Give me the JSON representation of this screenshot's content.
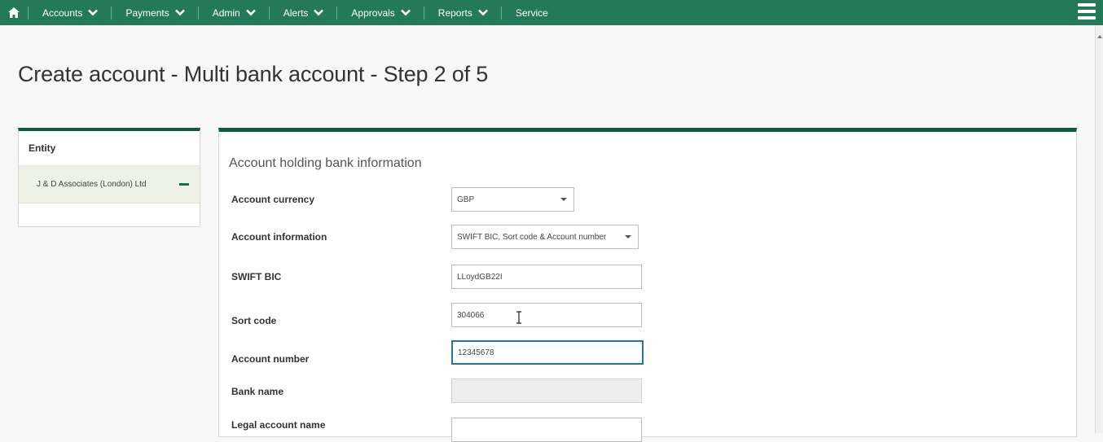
{
  "colors": {
    "nav_bg": "#24795a",
    "accent": "#0f5a44",
    "entity_selected_bg": "#eef1e6",
    "focus_border": "#2b6f9e"
  },
  "nav": {
    "home_icon": "home-icon",
    "items": [
      {
        "label": "Accounts",
        "has_dropdown": true
      },
      {
        "label": "Payments",
        "has_dropdown": true
      },
      {
        "label": "Admin",
        "has_dropdown": true
      },
      {
        "label": "Alerts",
        "has_dropdown": true
      },
      {
        "label": "Approvals",
        "has_dropdown": true
      },
      {
        "label": "Reports",
        "has_dropdown": true
      },
      {
        "label": "Service",
        "has_dropdown": false
      }
    ],
    "menu_icon": "hamburger-menu-icon"
  },
  "page": {
    "title": "Create account - Multi bank account - Step 2 of 5"
  },
  "entity": {
    "heading": "Entity",
    "selected": "J & D Associates (London) Ltd",
    "collapse_icon": "minus-icon"
  },
  "form": {
    "section_title": "Account holding bank information",
    "account_currency": {
      "label": "Account currency",
      "value": "GBP"
    },
    "account_information": {
      "label": "Account information",
      "value": "SWIFT BIC, Sort code & Account number"
    },
    "swift_bic": {
      "label": "SWIFT BIC",
      "value": "LLoydGB22I"
    },
    "sort_code": {
      "label": "Sort code",
      "value": "304066"
    },
    "account_number": {
      "label": "Account number",
      "value": "12345678"
    },
    "bank_name": {
      "label": "Bank name",
      "value": ""
    },
    "legal_account_name": {
      "label": "Legal account name",
      "value": ""
    }
  }
}
